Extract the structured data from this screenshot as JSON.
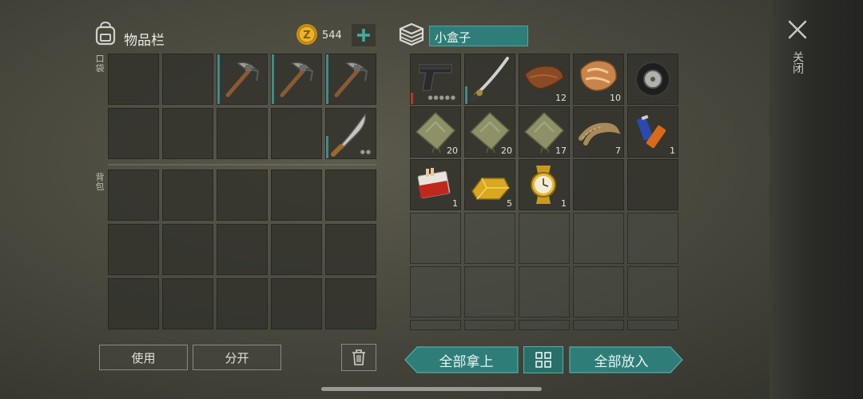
{
  "inventory": {
    "title": "物品栏",
    "coins": "544",
    "pocket_label": "口袋",
    "backpack_label": "背包"
  },
  "container": {
    "name": "小盒子"
  },
  "close": {
    "label": "关闭"
  },
  "buttons": {
    "use": "使用",
    "split": "分开",
    "take_all": "全部拿上",
    "put_all": "全部放入"
  },
  "pocket_slots": [
    {
      "item": "",
      "count": ""
    },
    {
      "item": "",
      "count": ""
    },
    {
      "item": "pickaxe",
      "count": ""
    },
    {
      "item": "pickaxe",
      "count": ""
    },
    {
      "item": "pickaxe",
      "count": ""
    },
    {
      "item": "",
      "count": ""
    },
    {
      "item": "",
      "count": ""
    },
    {
      "item": "",
      "count": ""
    },
    {
      "item": "",
      "count": ""
    },
    {
      "item": "machete",
      "count": ""
    }
  ],
  "container_items": [
    {
      "item": "pistol",
      "count": ""
    },
    {
      "item": "katana",
      "count": ""
    },
    {
      "item": "leather",
      "count": "12"
    },
    {
      "item": "fur",
      "count": "10"
    },
    {
      "item": "tire",
      "count": ""
    },
    {
      "item": "cloth",
      "count": "20"
    },
    {
      "item": "cloth",
      "count": "20"
    },
    {
      "item": "cloth",
      "count": "17"
    },
    {
      "item": "rope",
      "count": "7"
    },
    {
      "item": "batteries",
      "count": "1"
    },
    {
      "item": "cigarettes",
      "count": "1"
    },
    {
      "item": "gold-bar",
      "count": "5"
    },
    {
      "item": "gold-watch",
      "count": "1"
    }
  ],
  "colors": {
    "accent": "#3e8c8a",
    "button_teal": "#2f7d79",
    "coin": "#d9a21c"
  }
}
